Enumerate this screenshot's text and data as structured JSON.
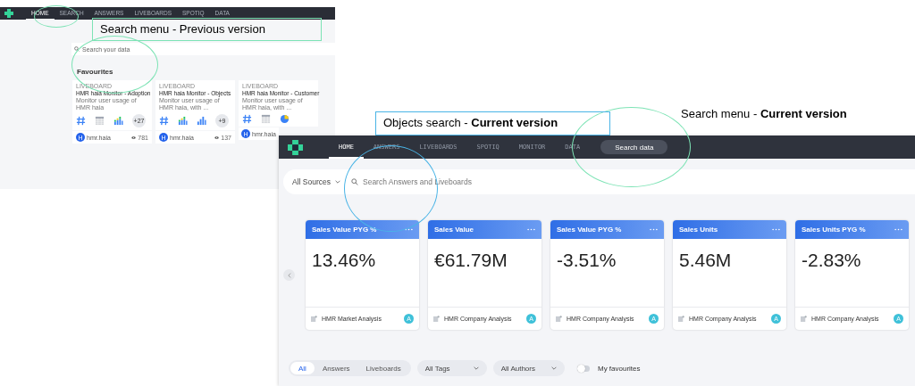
{
  "previous_version": {
    "nav_tabs": [
      {
        "label": "HOME",
        "selected": true
      },
      {
        "label": "SEARCH",
        "selected": false
      },
      {
        "label": "ANSWERS",
        "selected": false
      },
      {
        "label": "LIVEBOARDS",
        "selected": false
      },
      {
        "label": "SPOTIQ",
        "selected": false
      },
      {
        "label": "DATA",
        "selected": false
      }
    ],
    "search": {
      "placeholder": "Search your data"
    },
    "section_title": "Favourites",
    "cards": [
      {
        "type_label": "LIVEBOARD",
        "title": "HMR haia Monitor - Adoption",
        "description": "Monitor user usage of HMR haia",
        "tiles": [
          {
            "kind": "number"
          },
          {
            "kind": "table"
          },
          {
            "kind": "stacked"
          }
        ],
        "more": "+27",
        "owner_initial": "H",
        "owner": "hmr.haia",
        "views": "781"
      },
      {
        "type_label": "LIVEBOARD",
        "title": "HMR haia Monitor - Objects",
        "description": "Monitor user usage of HMR haia, with ...",
        "tiles": [
          {
            "kind": "number"
          },
          {
            "kind": "stacked"
          },
          {
            "kind": "bar"
          }
        ],
        "more": "+9",
        "owner_initial": "H",
        "owner": "hmr.haia",
        "views": "137"
      },
      {
        "type_label": "LIVEBOARD",
        "title": "HMR haia Monitor - Customer",
        "description": "Monitor user usage of HMR haia, with ...",
        "tiles": [
          {
            "kind": "number"
          },
          {
            "kind": "table"
          },
          {
            "kind": "pie"
          }
        ],
        "owner_initial": "H",
        "owner": "hmr.haia"
      }
    ]
  },
  "current_version": {
    "nav_tabs": [
      {
        "label": "HOME",
        "selected": true
      },
      {
        "label": "ANSWERS",
        "selected": false
      },
      {
        "label": "LIVEBOARDS",
        "selected": false
      },
      {
        "label": "SPOTIQ",
        "selected": false
      },
      {
        "label": "MONITOR",
        "selected": false
      },
      {
        "label": "DATA",
        "selected": false
      }
    ],
    "search_button": "Search data",
    "source_filter": "All Sources",
    "search": {
      "placeholder": "Search Answers and Liveboards"
    },
    "kpi_cards": [
      {
        "title": "Sales Value PYG %",
        "value": "13.46%",
        "source": "HMR Market Analysis",
        "avatar": "A"
      },
      {
        "title": "Sales Value",
        "value": "€61.79M",
        "source": "HMR Company Analysis",
        "avatar": "A"
      },
      {
        "title": "Sales Value PYG %",
        "value": "-3.51%",
        "source": "HMR Company Analysis",
        "avatar": "A"
      },
      {
        "title": "Sales Units",
        "value": "5.46M",
        "source": "HMR Company Analysis",
        "avatar": "A"
      },
      {
        "title": "Sales Units PYG %",
        "value": "-2.83%",
        "source": "HMR Company Analysis",
        "avatar": "A"
      }
    ],
    "type_filters": [
      {
        "label": "All",
        "selected": true
      },
      {
        "label": "Answers",
        "selected": false
      },
      {
        "label": "Liveboards",
        "selected": false
      }
    ],
    "tag_filter": "All Tags",
    "author_filter": "All Authors",
    "favourites_toggle": {
      "label": "My favourites",
      "on": false
    }
  },
  "annotations": [
    {
      "text": "Search menu - Previous version",
      "boxed": true,
      "color": "#7de3b5"
    },
    {
      "text": "Objects search - **Current version**",
      "boxed": true,
      "color": "#4ab4e6"
    },
    {
      "text": "Search menu - **Current version**",
      "boxed": false,
      "color": "#000000"
    }
  ]
}
